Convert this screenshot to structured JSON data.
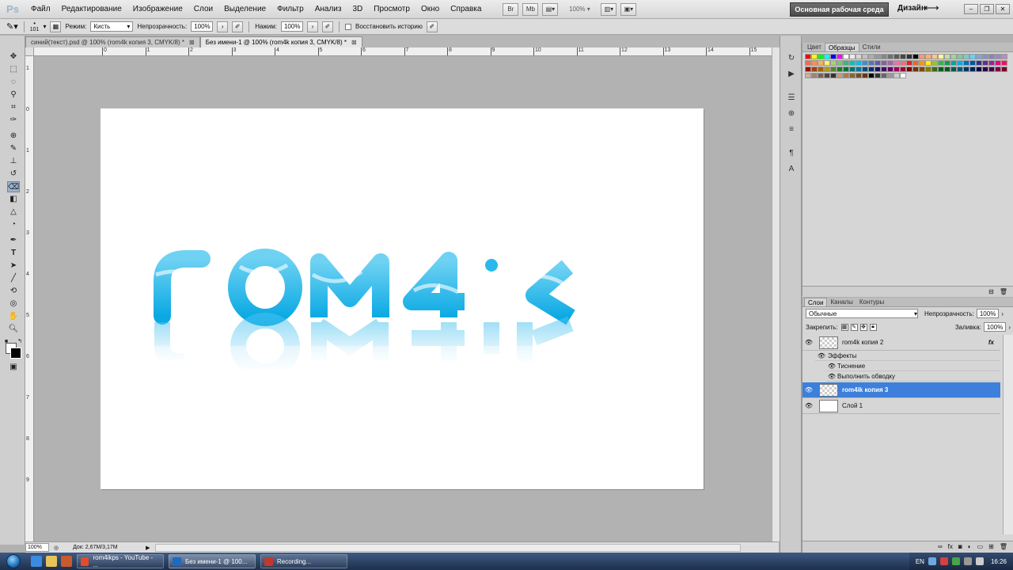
{
  "app": {
    "logo": "Ps",
    "menu": [
      "Файл",
      "Редактирование",
      "Изображение",
      "Слои",
      "Выделение",
      "Фильтр",
      "Анализ",
      "3D",
      "Просмотр",
      "Окно",
      "Справка"
    ],
    "icon_buttons": [
      "Br",
      "Mb"
    ],
    "zoom": "100%",
    "workspace": "Основная рабочая среда",
    "design": "Дизайн"
  },
  "options": {
    "brush_size": "101",
    "mode_label": "Режим:",
    "mode_value": "Кисть",
    "opacity_label": "Непрозрачность:",
    "opacity_value": "100%",
    "pressure_label": "Нажим:",
    "pressure_value": "100%",
    "erase_history": "Восстановить историю"
  },
  "tabs": [
    {
      "label": "синий(текст).psd @ 100% (rom4k копия 3, CMYK/8) *",
      "active": false
    },
    {
      "label": "Без имени-1 @ 100% (rom4k копия 3, CMYK/8) *",
      "active": true
    }
  ],
  "ruler_h": [
    "0",
    "1",
    "2",
    "3",
    "4",
    "5",
    "6",
    "7",
    "8",
    "9",
    "10",
    "11",
    "12",
    "13",
    "14",
    "15"
  ],
  "ruler_v": [
    "1",
    "0",
    "1",
    "2",
    "3",
    "4",
    "5",
    "6",
    "7",
    "8",
    "9"
  ],
  "canvas": {
    "artwork_text": "rom4ik",
    "text_color": "#25b8e8"
  },
  "status": {
    "zoom": "100%",
    "doc_info": "Док: 2,67M/3,17M"
  },
  "panels": {
    "swatches_tabs": [
      "Цвет",
      "Образцы",
      "Стили"
    ],
    "layers_tabs": [
      "Слои",
      "Каналы",
      "Контуры"
    ],
    "blend_mode": "Обычные",
    "opacity_label": "Непрозрачность:",
    "opacity_value": "100%",
    "lock_label": "Закрепить:",
    "fill_label": "Заливка:",
    "fill_value": "100%",
    "layers": [
      {
        "name": "rom4k копия 2",
        "fx": "fx",
        "selected": false
      },
      {
        "name": "rom4ik копия 3",
        "fx": "",
        "selected": true
      },
      {
        "name": "Слой 1",
        "fx": "",
        "selected": false
      }
    ],
    "effects_label": "Эффекты",
    "effects": [
      "Тиснение",
      "Выполнить обводку"
    ]
  },
  "taskbar": {
    "items": [
      {
        "label": "rom4ikps - YouTube - ...",
        "color": "#e44b2b"
      },
      {
        "label": "Без имени-1 @ 100...",
        "color": "#1b6bc4"
      },
      {
        "label": "Recording...",
        "color": "#c0392b"
      }
    ],
    "lang": "EN",
    "clock": "16:26"
  },
  "colors": {
    "selection": "#3d7fdb",
    "canvas_bg": "#b2b2b2",
    "brand_blue": "#25b8e8"
  }
}
